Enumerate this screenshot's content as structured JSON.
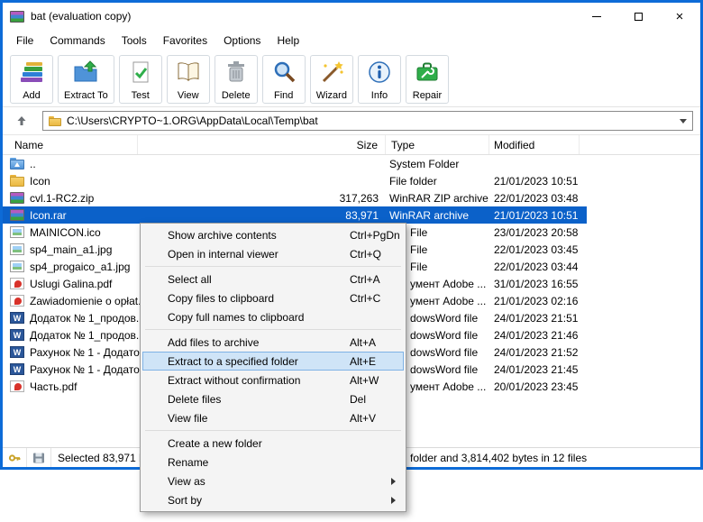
{
  "window": {
    "title": "bat (evaluation copy)"
  },
  "menubar": {
    "items": [
      {
        "label": "File"
      },
      {
        "label": "Commands"
      },
      {
        "label": "Tools"
      },
      {
        "label": "Favorites"
      },
      {
        "label": "Options"
      },
      {
        "label": "Help"
      }
    ]
  },
  "toolbar": {
    "buttons": [
      {
        "label": "Add"
      },
      {
        "label": "Extract To"
      },
      {
        "label": "Test"
      },
      {
        "label": "View"
      },
      {
        "label": "Delete"
      },
      {
        "label": "Find"
      },
      {
        "label": "Wizard"
      },
      {
        "label": "Info"
      },
      {
        "label": "Repair"
      }
    ]
  },
  "addressbar": {
    "path": "C:\\Users\\CRYPTO~1.ORG\\AppData\\Local\\Temp\\bat"
  },
  "filelist": {
    "columns": [
      {
        "label": "Name"
      },
      {
        "label": "Size"
      },
      {
        "label": "Type"
      },
      {
        "label": "Modified"
      }
    ],
    "rows": [
      {
        "name": "..",
        "size": "",
        "type": "System Folder",
        "modified": ""
      },
      {
        "name": "Icon",
        "size": "",
        "type": "File folder",
        "modified": "21/01/2023 10:51"
      },
      {
        "name": "cvl.1-RC2.zip",
        "size": "317,263",
        "type": "WinRAR ZIP archive",
        "modified": "22/01/2023 03:48"
      },
      {
        "name": "Icon.rar",
        "size": "83,971",
        "type": "WinRAR archive",
        "modified": "21/01/2023 10:51",
        "selected": true
      },
      {
        "name": "MAINICON.ico",
        "size": "",
        "type": "File",
        "modified": "23/01/2023 20:58"
      },
      {
        "name": "sp4_main_a1.jpg",
        "size": "",
        "type": "File",
        "modified": "22/01/2023 03:45"
      },
      {
        "name": "sp4_progaico_a1.jpg",
        "size": "",
        "type": "File",
        "modified": "22/01/2023 03:44"
      },
      {
        "name": "Uslugi Galina.pdf",
        "size": "",
        "type": "умент Adobe ...",
        "modified": "31/01/2023 16:55"
      },
      {
        "name": "Zawiadomienie o opłat...",
        "size": "",
        "type": "умент Adobe ...",
        "modified": "21/01/2023 02:16"
      },
      {
        "name": "Додаток № 1_продов...",
        "size": "",
        "type": "dowsWord file",
        "modified": "24/01/2023 21:51"
      },
      {
        "name": "Додаток № 1_продов...",
        "size": "",
        "type": "dowsWord file",
        "modified": "24/01/2023 21:46"
      },
      {
        "name": "Рахунок № 1 - Додато...",
        "size": "",
        "type": "dowsWord file",
        "modified": "24/01/2023 21:52"
      },
      {
        "name": "Рахунок № 1 - Додато...",
        "size": "",
        "type": "dowsWord file",
        "modified": "24/01/2023 21:45"
      },
      {
        "name": "Часть.pdf",
        "size": "",
        "type": "умент Adobe ...",
        "modified": "20/01/2023 23:45"
      }
    ]
  },
  "context_menu": {
    "items": [
      {
        "label": "Show archive contents",
        "shortcut": "Ctrl+PgDn"
      },
      {
        "label": "Open in internal viewer",
        "shortcut": "Ctrl+Q"
      },
      {
        "separator": true
      },
      {
        "label": "Select all",
        "shortcut": "Ctrl+A"
      },
      {
        "label": "Copy files to clipboard",
        "shortcut": "Ctrl+C"
      },
      {
        "label": "Copy full names to clipboard",
        "shortcut": ""
      },
      {
        "separator": true
      },
      {
        "label": "Add files to archive",
        "shortcut": "Alt+A"
      },
      {
        "label": "Extract to a specified folder",
        "shortcut": "Alt+E",
        "highlighted": true
      },
      {
        "label": "Extract without confirmation",
        "shortcut": "Alt+W"
      },
      {
        "label": "Delete files",
        "shortcut": "Del"
      },
      {
        "label": "View file",
        "shortcut": "Alt+V"
      },
      {
        "separator": true
      },
      {
        "label": "Create a new folder",
        "shortcut": ""
      },
      {
        "label": "Rename",
        "shortcut": ""
      },
      {
        "label": "View as",
        "shortcut": "",
        "submenu": true
      },
      {
        "label": "Sort by",
        "shortcut": "",
        "submenu": true
      }
    ]
  },
  "statusbar": {
    "left_text": "Selected 83,971 byt",
    "right_text": "folder and 3,814,402 bytes in 12 files"
  },
  "colors": {
    "accent": "#0d6bd7",
    "selection": "#0b61c9",
    "menu_highlight": "#cfe4f7"
  }
}
